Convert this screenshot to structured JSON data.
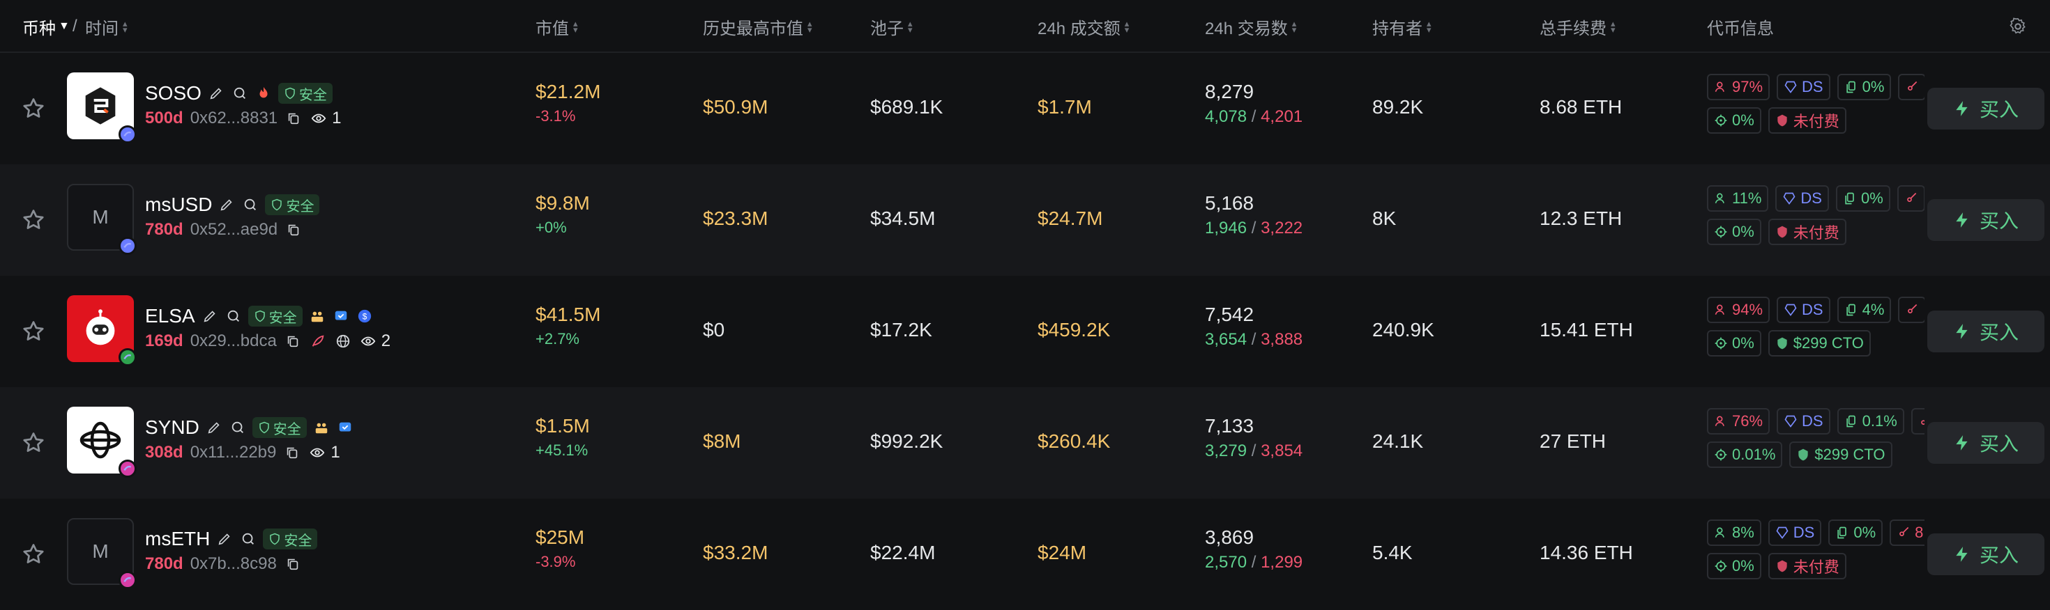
{
  "header": {
    "token_label": "币种",
    "time_label": "时间",
    "separator": "/",
    "columns": [
      "市值",
      "历史最高市值",
      "池子",
      "24h 成交额",
      "24h 交易数",
      "持有者",
      "总手续费",
      "代币信息"
    ]
  },
  "buy_label": "买入",
  "safe_label": "安全",
  "colors": {
    "gold": "#f5c46a",
    "green": "#5fd18f",
    "red": "#f0546f",
    "safe_bg": "#1d3324"
  },
  "rows": [
    {
      "name": "SOSO",
      "age": "500d",
      "address": "0x62...8831",
      "watchers": "1",
      "market_cap": "$21.2M",
      "change": "-3.1%",
      "change_dir": "neg",
      "ath": "$50.9M",
      "ath_gold": true,
      "pool": "$689.1K",
      "volume": "$1.7M",
      "txns": "8,279",
      "buys": "4,078",
      "sells": "4,201",
      "holders": "89.2K",
      "fees": "8.68 ETH",
      "tag_row1": [
        {
          "icon": "user-icon",
          "text": "97%",
          "color": "red"
        },
        {
          "icon": "ds-icon",
          "text": "DS",
          "color": "blue"
        },
        {
          "icon": "copy-icon",
          "text": "0%",
          "color": "green"
        },
        {
          "icon": "sniper-icon",
          "text": "",
          "color": "red"
        }
      ],
      "tag_row2": [
        {
          "icon": "target-icon",
          "text": "0%",
          "color": "green"
        },
        {
          "icon": "paid-icon",
          "text": "未付费",
          "color": "red"
        }
      ]
    },
    {
      "name": "msUSD",
      "age": "780d",
      "address": "0x52...ae9d",
      "watchers": "",
      "market_cap": "$9.8M",
      "change": "+0%",
      "change_dir": "pos",
      "ath": "$23.3M",
      "ath_gold": true,
      "pool": "$34.5M",
      "volume": "$24.7M",
      "txns": "5,168",
      "buys": "1,946",
      "sells": "3,222",
      "holders": "8K",
      "fees": "12.3 ETH",
      "tag_row1": [
        {
          "icon": "user-icon",
          "text": "11%",
          "color": "green"
        },
        {
          "icon": "ds-icon",
          "text": "DS",
          "color": "blue"
        },
        {
          "icon": "copy-icon",
          "text": "0%",
          "color": "green"
        },
        {
          "icon": "sniper-icon",
          "text": "",
          "color": "red"
        }
      ],
      "tag_row2": [
        {
          "icon": "target-icon",
          "text": "0%",
          "color": "green"
        },
        {
          "icon": "paid-icon",
          "text": "未付费",
          "color": "red"
        }
      ]
    },
    {
      "name": "ELSA",
      "age": "169d",
      "address": "0x29...bdca",
      "watchers": "2",
      "market_cap": "$41.5M",
      "change": "+2.7%",
      "change_dir": "pos",
      "ath": "$0",
      "ath_gold": false,
      "pool": "$17.2K",
      "volume": "$459.2K",
      "txns": "7,542",
      "buys": "3,654",
      "sells": "3,888",
      "holders": "240.9K",
      "fees": "15.41 ETH",
      "tag_row1": [
        {
          "icon": "user-icon",
          "text": "94%",
          "color": "red"
        },
        {
          "icon": "ds-icon",
          "text": "DS",
          "color": "blue"
        },
        {
          "icon": "copy-icon",
          "text": "4%",
          "color": "green"
        },
        {
          "icon": "sniper-icon",
          "text": "",
          "color": "red"
        }
      ],
      "tag_row2": [
        {
          "icon": "target-icon",
          "text": "0%",
          "color": "green"
        },
        {
          "icon": "paid-icon",
          "text": "$299 CTO",
          "color": "green"
        }
      ]
    },
    {
      "name": "SYND",
      "age": "308d",
      "address": "0x11...22b9",
      "watchers": "1",
      "market_cap": "$1.5M",
      "change": "+45.1%",
      "change_dir": "pos",
      "ath": "$8M",
      "ath_gold": true,
      "pool": "$992.2K",
      "volume": "$260.4K",
      "txns": "7,133",
      "buys": "3,279",
      "sells": "3,854",
      "holders": "24.1K",
      "fees": "27 ETH",
      "tag_row1": [
        {
          "icon": "user-icon",
          "text": "76%",
          "color": "red"
        },
        {
          "icon": "ds-icon",
          "text": "DS",
          "color": "blue"
        },
        {
          "icon": "copy-icon",
          "text": "0.1%",
          "color": "green"
        },
        {
          "icon": "sniper-icon",
          "text": "",
          "color": "red"
        }
      ],
      "tag_row2": [
        {
          "icon": "target-icon",
          "text": "0.01%",
          "color": "green"
        },
        {
          "icon": "paid-icon",
          "text": "$299 CTO",
          "color": "green"
        }
      ]
    },
    {
      "name": "msETH",
      "age": "780d",
      "address": "0x7b...8c98",
      "watchers": "",
      "market_cap": "$25M",
      "change": "-3.9%",
      "change_dir": "neg",
      "ath": "$33.2M",
      "ath_gold": true,
      "pool": "$22.4M",
      "volume": "$24M",
      "txns": "3,869",
      "buys": "2,570",
      "sells": "1,299",
      "holders": "5.4K",
      "fees": "14.36 ETH",
      "tag_row1": [
        {
          "icon": "user-icon",
          "text": "8%",
          "color": "green"
        },
        {
          "icon": "ds-icon",
          "text": "DS",
          "color": "blue"
        },
        {
          "icon": "copy-icon",
          "text": "0%",
          "color": "green"
        },
        {
          "icon": "sniper-icon",
          "text": "8",
          "color": "red"
        }
      ],
      "tag_row2": [
        {
          "icon": "target-icon",
          "text": "0%",
          "color": "green"
        },
        {
          "icon": "paid-icon",
          "text": "未付费",
          "color": "red"
        }
      ]
    }
  ]
}
